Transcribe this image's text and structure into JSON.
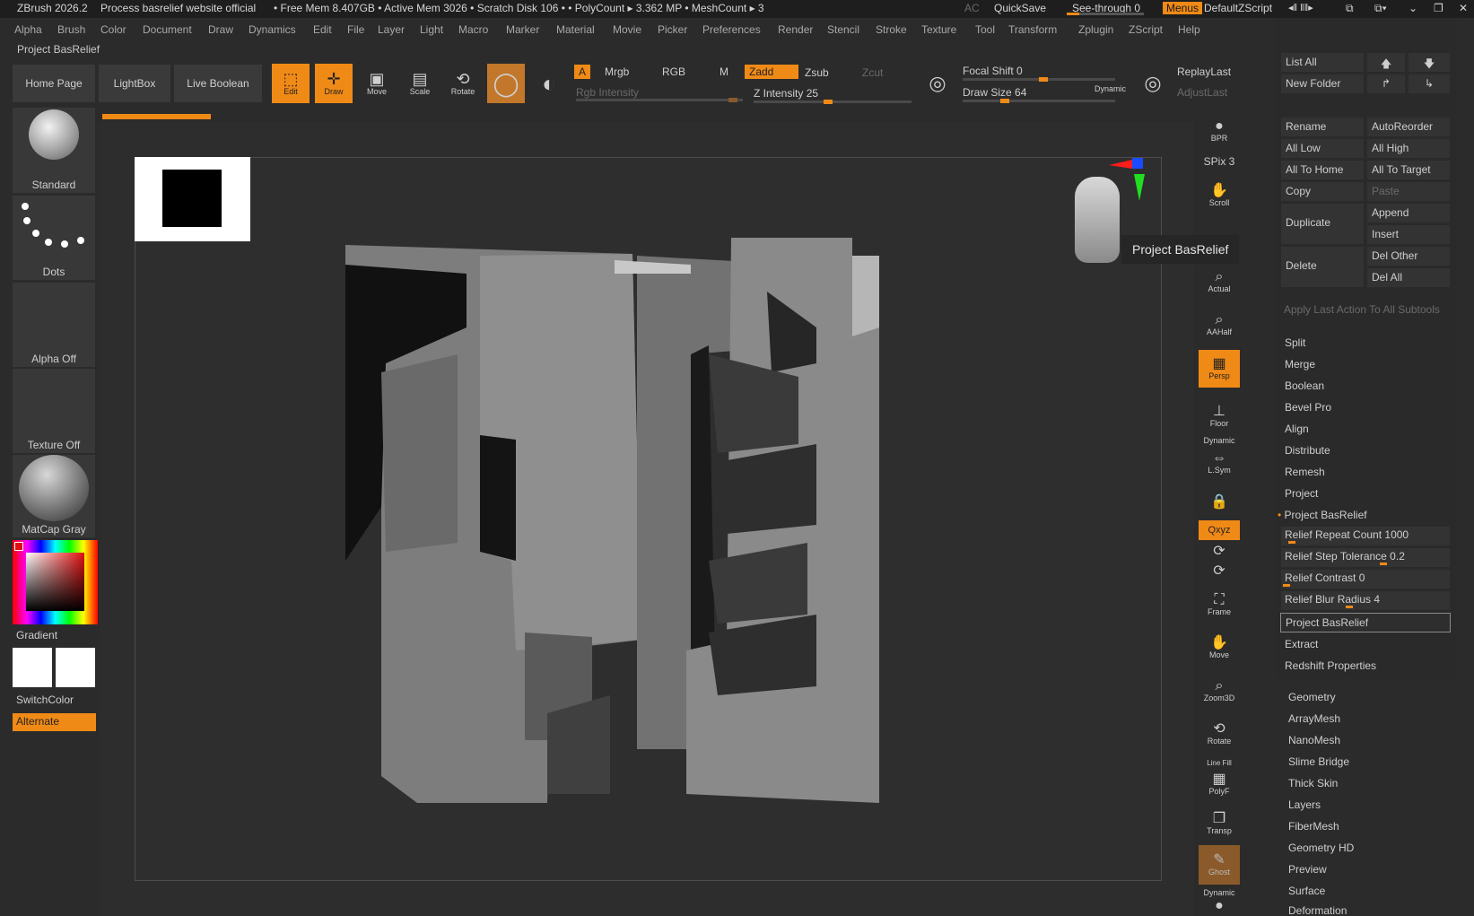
{
  "titlebar": {
    "app": "ZBrush 2026.2",
    "doc": "Process basrelief website official",
    "stats": "• Free Mem 8.407GB • Active Mem 3026 • Scratch Disk 106 •  • PolyCount ▸ 3.362 MP  • MeshCount ▸ 3",
    "ac": "AC",
    "quicksave": "QuickSave",
    "see_through": "See-through  0",
    "see_through_value": 0,
    "menus": "Menus",
    "script": "DefaultZScript"
  },
  "menubar": [
    "Alpha",
    "Brush",
    "Color",
    "Document",
    "Draw",
    "Dynamics",
    "Edit",
    "File",
    "Layer",
    "Light",
    "Macro",
    "Marker",
    "Material",
    "Movie",
    "Picker",
    "Preferences",
    "Render",
    "Stencil",
    "Stroke",
    "Texture",
    "Tool",
    "Transform",
    "Zplugin",
    "ZScript",
    "Help"
  ],
  "subtitle": "Project BasRelief",
  "toolbar": {
    "home": "Home Page",
    "lightbox": "LightBox",
    "live_boolean": "Live Boolean",
    "edit": "Edit",
    "draw": "Draw",
    "move": "Move",
    "scale": "Scale",
    "rotate": "Rotate",
    "a": "A",
    "mrgb": "Mrgb",
    "rgb": "RGB",
    "m": "M",
    "zadd": "Zadd",
    "zsub": "Zsub",
    "zcut": "Zcut",
    "rgb_intensity": "Rgb Intensity",
    "z_intensity": "Z Intensity 25",
    "focal_shift": "Focal Shift 0",
    "draw_size": "Draw Size 64",
    "dynamic": "Dynamic",
    "replay_last": "ReplayLast",
    "adjust_last": "AdjustLast"
  },
  "shelf": {
    "brush": "Standard",
    "stroke": "Dots",
    "alpha": "Alpha Off",
    "texture": "Texture Off",
    "material": "MatCap Gray",
    "gradient": "Gradient",
    "switch": "SwitchColor",
    "alternate": "Alternate"
  },
  "tooltip": "Project BasRelief",
  "right_icons": {
    "bpr": "BPR",
    "spix": "SPix 3",
    "scroll": "Scroll",
    "actual": "Actual",
    "aahalf": "AAHalf",
    "persp": "Persp",
    "floor": "Floor",
    "dynamic": "Dynamic",
    "lsym": "L.Sym",
    "xyz": "Qxyz",
    "frame": "Frame",
    "move": "Move",
    "zoom3d": "Zoom3D",
    "rotate": "Rotate",
    "linefill": "Line Fill",
    "polyf": "PolyF",
    "transp": "Transp",
    "ghost": "Ghost",
    "dynamic2": "Dynamic"
  },
  "panel": {
    "list_all": "List All",
    "new_folder": "New Folder",
    "rename": "Rename",
    "auto_reorder": "AutoReorder",
    "all_low": "All Low",
    "all_high": "All High",
    "all_to_home": "All To Home",
    "all_to_target": "All To Target",
    "copy": "Copy",
    "paste": "Paste",
    "duplicate": "Duplicate",
    "append": "Append",
    "insert": "Insert",
    "delete": "Delete",
    "del_other": "Del Other",
    "del_all": "Del All",
    "apply_last": "Apply Last Action To All Subtools",
    "items": [
      "Split",
      "Merge",
      "Boolean",
      "Bevel Pro",
      "Align",
      "Distribute",
      "Remesh",
      "Project"
    ],
    "project_basrelief": "Project BasRelief",
    "relief_repeat": "Relief Repeat Count 1000",
    "relief_step": "Relief Step Tolerance 0.2",
    "relief_contrast": "Relief Contrast 0",
    "relief_blur": "Relief Blur Radius 4",
    "project_basrelief_btn": "Project BasRelief",
    "extract": "Extract",
    "redshift": "Redshift Properties"
  },
  "subpalettes": [
    "Geometry",
    "ArrayMesh",
    "NanoMesh",
    "Slime Bridge",
    "Thick Skin",
    "Layers",
    "FiberMesh",
    "Geometry HD",
    "Preview",
    "Surface",
    "Deformation"
  ],
  "colors": {
    "accent": "#f08a16",
    "background": "#2b2b2b",
    "panel": "#333333"
  }
}
